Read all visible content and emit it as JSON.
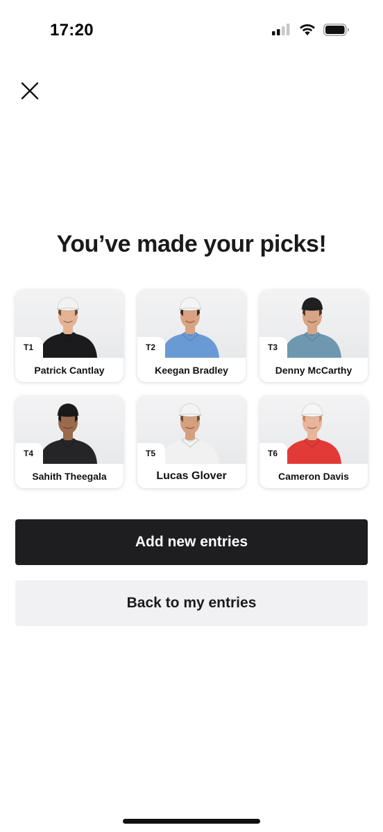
{
  "status_bar": {
    "time": "17:20"
  },
  "title": "You’ve made your picks!",
  "picks": [
    {
      "rank": "T1",
      "name": "Patrick Cantlay",
      "cap_color": "#f2f2f2",
      "shirt_color": "#1b1b1d",
      "skin_color": "#e4b393",
      "hair_color": "#6b4a2e"
    },
    {
      "rank": "T2",
      "name": "Keegan Bradley",
      "cap_color": "#f4f4f4",
      "shirt_color": "#6a9ad4",
      "skin_color": "#d9a282",
      "hair_color": "#3a2a1e"
    },
    {
      "rank": "T3",
      "name": "Denny McCarthy",
      "cap_color": "#1f1f22",
      "shirt_color": "#6e97b0",
      "skin_color": "#d7a585",
      "hair_color": "#4e3524"
    },
    {
      "rank": "T4",
      "name": "Sahith Theegala",
      "cap_color": "#1a1a1a",
      "shirt_color": "#252527",
      "skin_color": "#9a6a4c",
      "hair_color": "#1a1a1a"
    },
    {
      "rank": "T5",
      "name": "Lucas Glover",
      "cap_color": "#f3f3f3",
      "shirt_color": "#f1f1f1",
      "skin_color": "#d4a07e",
      "hair_color": "#6b5035"
    },
    {
      "rank": "T6",
      "name": "Cameron Davis",
      "cap_color": "#f6f6f6",
      "shirt_color": "#e23a36",
      "skin_color": "#e8b59a",
      "hair_color": "#c08b58"
    }
  ],
  "buttons": {
    "primary_label": "Add new entries",
    "secondary_label": "Back to my entries"
  }
}
